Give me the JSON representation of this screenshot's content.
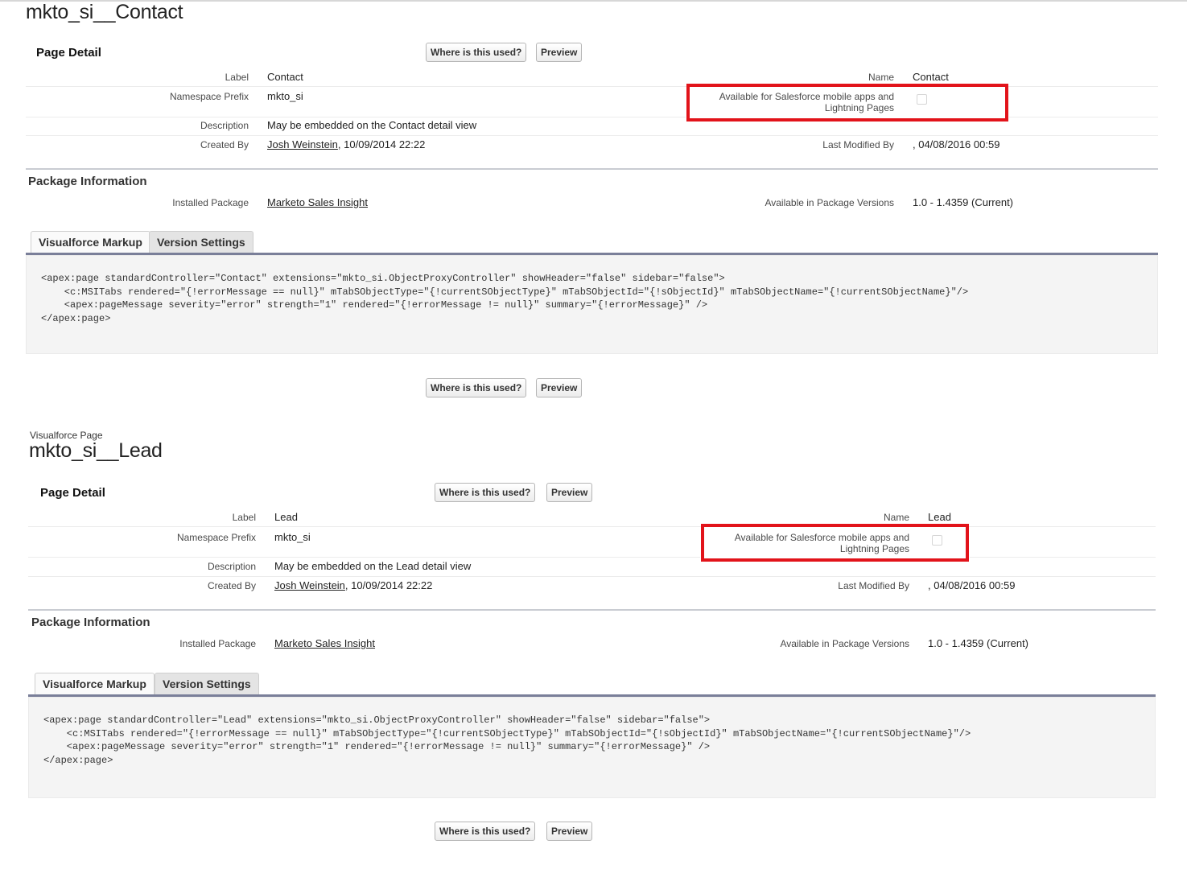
{
  "pages": [
    {
      "type_label": "",
      "title": "mkto_si__Contact",
      "page_detail_title": "Page Detail",
      "buttons": {
        "where_used": "Where is this used?",
        "preview": "Preview"
      },
      "fields": {
        "label_label": "Label",
        "label_value": "Contact",
        "name_label": "Name",
        "name_value": "Contact",
        "namespace_label": "Namespace Prefix",
        "namespace_value": "mkto_si",
        "mobile_label_1": "Available for Salesforce mobile apps and",
        "mobile_label_2": "Lightning Pages",
        "mobile_checked": false,
        "description_label": "Description",
        "description_value": "May be embedded on the Contact detail view",
        "created_by_label": "Created By",
        "created_by_name": "Josh Weinstein",
        "created_by_date": ", 10/09/2014 22:22",
        "last_modified_label": "Last Modified By",
        "last_modified_value": ", 04/08/2016 00:59"
      },
      "package": {
        "title": "Package Information",
        "installed_label": "Installed Package",
        "installed_value": "Marketo Sales Insight",
        "versions_label": "Available in Package Versions",
        "versions_value": "1.0 - 1.4359 (Current)"
      },
      "tabs": [
        "Visualforce Markup",
        "Version Settings"
      ],
      "code_lines": [
        "<apex:page standardController=\"Contact\" extensions=\"mkto_si.ObjectProxyController\" showHeader=\"false\" sidebar=\"false\">",
        "    <c:MSITabs rendered=\"{!errorMessage == null}\" mTabSObjectType=\"{!currentSObjectType}\" mTabSObjectId=\"{!sObjectId}\" mTabSObjectName=\"{!currentSObjectName}\"/>",
        "    <apex:pageMessage severity=\"error\" strength=\"1\" rendered=\"{!errorMessage != null}\" summary=\"{!errorMessage}\" />",
        "</apex:page>"
      ]
    },
    {
      "type_label": "Visualforce Page",
      "title": "mkto_si__Lead",
      "page_detail_title": "Page Detail",
      "buttons": {
        "where_used": "Where is this used?",
        "preview": "Preview"
      },
      "fields": {
        "label_label": "Label",
        "label_value": "Lead",
        "name_label": "Name",
        "name_value": "Lead",
        "namespace_label": "Namespace Prefix",
        "namespace_value": "mkto_si",
        "mobile_label_1": "Available for Salesforce mobile apps and",
        "mobile_label_2": "Lightning Pages",
        "mobile_checked": false,
        "description_label": "Description",
        "description_value": "May be embedded on the Lead detail view",
        "created_by_label": "Created By",
        "created_by_name": "Josh Weinstein",
        "created_by_date": ", 10/09/2014 22:22",
        "last_modified_label": "Last Modified By",
        "last_modified_value": ", 04/08/2016 00:59"
      },
      "package": {
        "title": "Package Information",
        "installed_label": "Installed Package",
        "installed_value": "Marketo Sales Insight",
        "versions_label": "Available in Package Versions",
        "versions_value": "1.0 - 1.4359 (Current)"
      },
      "tabs": [
        "Visualforce Markup",
        "Version Settings"
      ],
      "code_lines": [
        "<apex:page standardController=\"Lead\" extensions=\"mkto_si.ObjectProxyController\" showHeader=\"false\" sidebar=\"false\">",
        "    <c:MSITabs rendered=\"{!errorMessage == null}\" mTabSObjectType=\"{!currentSObjectType}\" mTabSObjectId=\"{!sObjectId}\" mTabSObjectName=\"{!currentSObjectName}\"/>",
        "    <apex:pageMessage severity=\"error\" strength=\"1\" rendered=\"{!errorMessage != null}\" summary=\"{!errorMessage}\" />",
        "</apex:page>"
      ]
    }
  ],
  "colors": {
    "highlight_box": "#e2131a",
    "tab_underline": "#7a7f99",
    "code_bg": "#f4f4f4"
  }
}
